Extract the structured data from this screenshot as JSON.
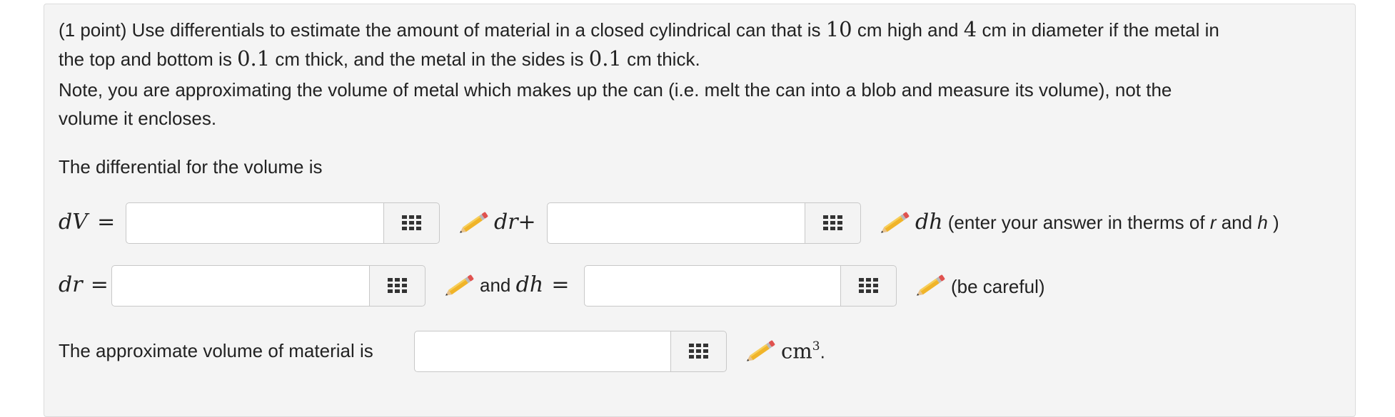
{
  "problem": {
    "line1_prefix": "(1 point) Use differentials to estimate the amount of material in a closed cylindrical can that is",
    "height_value": "10",
    "line1_mid": "cm high and",
    "diameter_value": "4",
    "line1_suffix": "cm in diameter if the metal in",
    "line2_prefix": "the top and bottom is",
    "top_thickness": "0.1",
    "line2_mid": "cm thick, and the metal in the sides is",
    "side_thickness": "0.1",
    "line2_suffix": "cm thick.",
    "note_line1": "Note, you are approximating the volume of metal which makes up the can (i.e. melt the can into a blob and measure its volume), not the",
    "note_line2": "volume it encloses.",
    "differential_intro": "The differential for the volume is"
  },
  "row_dV": {
    "lhs_var": "dV",
    "equals": "=",
    "dr_term": "dr",
    "plus": "+",
    "dh_term": "dh",
    "hint_prefix": "(enter your answer in therms of",
    "hint_r": "r",
    "hint_and": "and",
    "hint_h": "h",
    "hint_suffix": ")",
    "input1_value": "",
    "input2_value": ""
  },
  "row_dr": {
    "lhs_var": "dr",
    "equals": "=",
    "and_text": "and",
    "dh_var": "dh",
    "dh_equals": "=",
    "careful": "(be careful)",
    "input1_value": "",
    "input2_value": ""
  },
  "row_volume": {
    "label": "The approximate volume of material is",
    "unit": "cm",
    "unit_exp": "3",
    "period": ".",
    "input_value": ""
  },
  "icons": {
    "equation_editor": "keypad-grid-icon",
    "answer_help": "pencil-icon"
  },
  "colors": {
    "panel_bg": "#f4f4f4",
    "input_border": "#c8c8c8",
    "pencil_body": "#f0b429",
    "pencil_eraser": "#e0524f"
  }
}
